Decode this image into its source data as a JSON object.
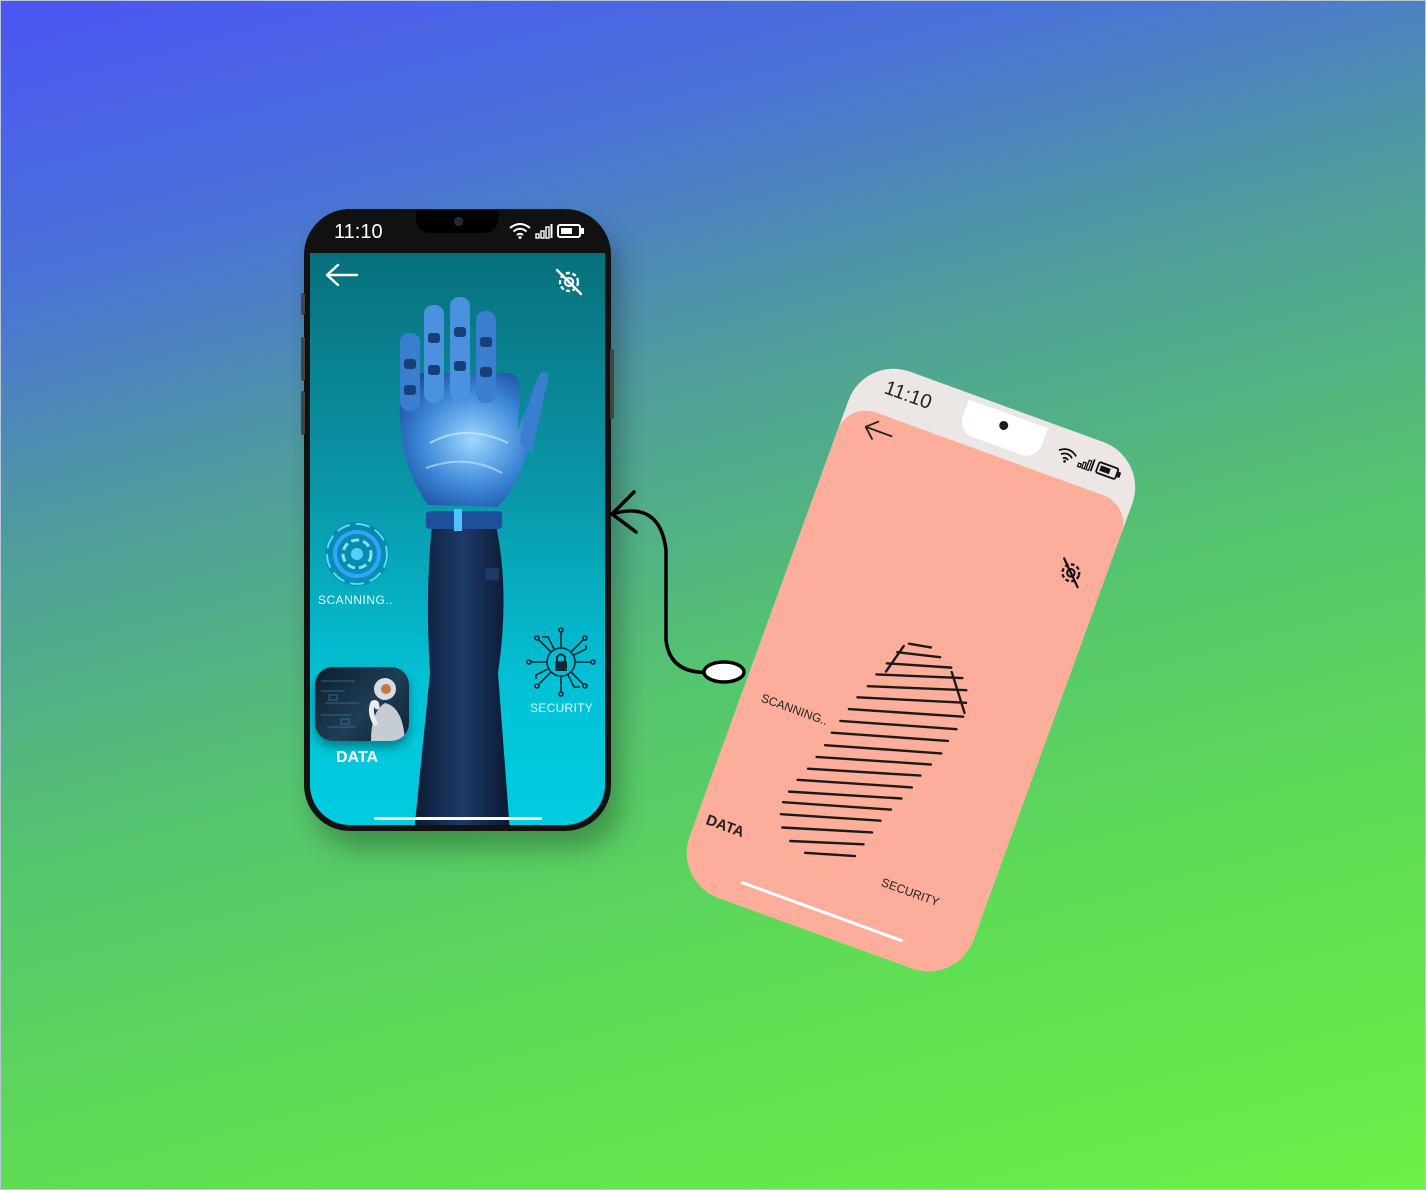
{
  "background": {
    "gradient_top": "#4a55f5",
    "gradient_bottom": "#6cf046"
  },
  "phone_primary": {
    "status_time": "11:10",
    "back_icon": "arrow-left-icon",
    "settings_icon": "gear-off-icon",
    "scanning_label": "SCANNING..",
    "security_label": "SECURITY",
    "data_label": "DATA",
    "screen_color": "#03c1d6"
  },
  "phone_sketch": {
    "status_time": "11:10",
    "back_icon": "arrow-left-icon",
    "settings_icon": "gear-off-icon",
    "scanning_label": "SCANNING..",
    "data_label": "DATA",
    "security_label": "SECURITY",
    "screen_color": "#fdae9b"
  },
  "connector": {
    "icon": "curved-arrow-icon"
  }
}
